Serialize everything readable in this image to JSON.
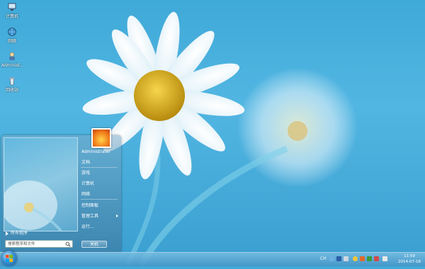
{
  "desktop": {
    "icons": [
      {
        "label": "计算机"
      },
      {
        "label": "网络"
      },
      {
        "label": "Administ..."
      },
      {
        "label": "回收站"
      }
    ]
  },
  "start_menu": {
    "all_programs": "所有程序",
    "search_placeholder": "搜索程序和文件",
    "user_name": "Administrator",
    "items": [
      {
        "label": "文档"
      },
      {
        "label": "游戏"
      },
      {
        "label": "计算机"
      },
      {
        "label": "网络"
      },
      {
        "label": "控制面板"
      },
      {
        "label": "管理工具"
      },
      {
        "label": "运行..."
      }
    ],
    "shutdown_label": "关机"
  },
  "taskbar": {
    "language": "CH",
    "time": "11:59",
    "date": "2014-07-18"
  },
  "colors": {
    "wallpaper": "#3fa9d8",
    "flower_center": "#e8b21a",
    "petal": "#ffffff"
  }
}
